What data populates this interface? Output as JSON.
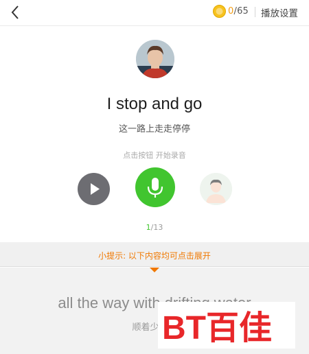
{
  "header": {
    "coin_current": "0",
    "coin_total": "/65",
    "settings_label": "播放设置"
  },
  "main": {
    "sentence_en": "I stop and go",
    "sentence_cn": "这一路上走走停停",
    "record_hint": "点击按钮 开始录音",
    "progress_current": "1",
    "progress_total": "/13"
  },
  "tip": {
    "text": "小提示: 以下内容均可点击展开"
  },
  "next": {
    "sentence_en": "all the way with drifting water",
    "sentence_cn": "顺着少年漂"
  },
  "watermark": {
    "text": "BT百佳"
  },
  "colors": {
    "accent_green": "#41c52f",
    "accent_orange": "#f07800",
    "coin_yellow": "#f7c21e",
    "watermark_red": "#e8272a"
  }
}
